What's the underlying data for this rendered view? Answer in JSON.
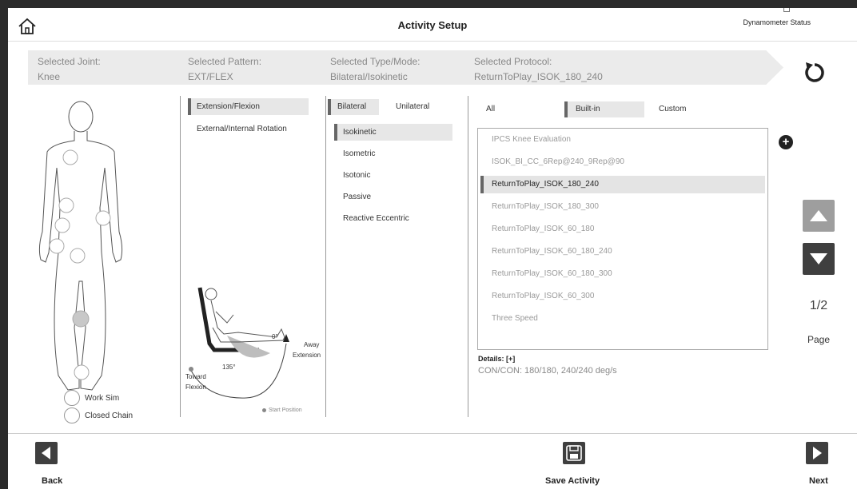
{
  "header": {
    "title": "Activity Setup",
    "dynamometer_status": "Dynamometer Status",
    "home_icon": "home-icon"
  },
  "summary": {
    "joint_label": "Selected Joint:",
    "joint_value": "Knee",
    "pattern_label": "Selected Pattern:",
    "pattern_value": "EXT/FLEX",
    "type_label": "Selected Type/Mode:",
    "type_value": "Bilateral/Isokinetic",
    "protocol_label": "Selected Protocol:",
    "protocol_value": "ReturnToPlay_ISOK_180_240"
  },
  "joint_options": {
    "work_sim": "Work Sim",
    "closed_chain": "Closed Chain"
  },
  "patterns": [
    {
      "label": "Extension/Flexion",
      "selected": true
    },
    {
      "label": "External/Internal Rotation",
      "selected": false
    }
  ],
  "diagram": {
    "angle_zero": "0°",
    "angle_max": "135°",
    "away": "Away",
    "extension": "Extension",
    "toward": "Toward",
    "flexion": "Flexion",
    "start_position": "Start Position"
  },
  "sides": {
    "bilateral": "Bilateral",
    "unilateral": "Unilateral",
    "selected": "Bilateral"
  },
  "modes": [
    {
      "label": "Isokinetic",
      "selected": true
    },
    {
      "label": "Isometric",
      "selected": false
    },
    {
      "label": "Isotonic",
      "selected": false
    },
    {
      "label": "Passive",
      "selected": false
    },
    {
      "label": "Reactive Eccentric",
      "selected": false
    }
  ],
  "filters": {
    "all": "All",
    "built_in": "Built-in",
    "custom": "Custom",
    "selected": "Built-in"
  },
  "protocols": [
    {
      "label": "IPCS Knee Evaluation",
      "selected": false
    },
    {
      "label": "ISOK_BI_CC_6Rep@240_9Rep@90",
      "selected": false
    },
    {
      "label": "ReturnToPlay_ISOK_180_240",
      "selected": true
    },
    {
      "label": "ReturnToPlay_ISOK_180_300",
      "selected": false
    },
    {
      "label": "ReturnToPlay_ISOK_60_180",
      "selected": false
    },
    {
      "label": "ReturnToPlay_ISOK_60_180_240",
      "selected": false
    },
    {
      "label": "ReturnToPlay_ISOK_60_180_300",
      "selected": false
    },
    {
      "label": "ReturnToPlay_ISOK_60_300",
      "selected": false
    },
    {
      "label": "Three Speed",
      "selected": false
    }
  ],
  "details": {
    "label": "Details:  [+]",
    "text": "CON/CON: 180/180, 240/240 deg/s"
  },
  "pager": {
    "page": "1/2",
    "label": "Page"
  },
  "footer": {
    "back": "Back",
    "save": "Save Activity",
    "next": "Next"
  },
  "colors": {
    "selected_bar": "#666666",
    "selected_bg": "#e7e7e7",
    "button_dark": "#3f3f3f",
    "button_disabled": "#9e9e9e"
  }
}
